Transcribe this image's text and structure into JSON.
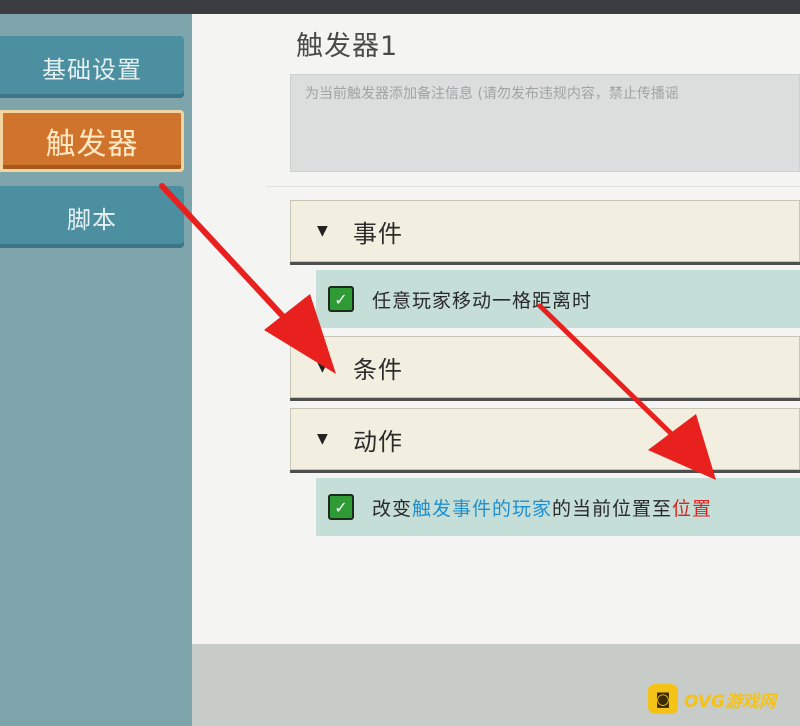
{
  "sidebar": {
    "items": [
      {
        "label": "基础设置"
      },
      {
        "label": "触发器"
      },
      {
        "label": "脚本"
      }
    ]
  },
  "main": {
    "title": "触发器1",
    "note_placeholder": "为当前触发器添加备注信息 (请勿发布违规内容，禁止传播谣",
    "sections": [
      {
        "label": "事件",
        "items": [
          {
            "text": "任意玩家移动一格距离时"
          }
        ]
      },
      {
        "label": "条件",
        "items": []
      },
      {
        "label": "动作",
        "items": [
          {
            "prefix": "改变",
            "link1": "触发事件的玩家",
            "middle": "的当前位置至",
            "link2": "位置"
          }
        ]
      }
    ]
  },
  "watermark": {
    "text": "OVG游戏网"
  },
  "colors": {
    "accent_orange": "#d0732c",
    "sidebar_teal": "#4c8fa1",
    "check_green": "#2e9b34",
    "link_blue": "#1f8fd0",
    "link_red": "#e0211f",
    "arrow_red": "#e8201e"
  },
  "icons": {
    "collapse": "triangle-down-icon",
    "check": "checkbox-checked-icon",
    "annotation": "red-arrow-icon"
  }
}
